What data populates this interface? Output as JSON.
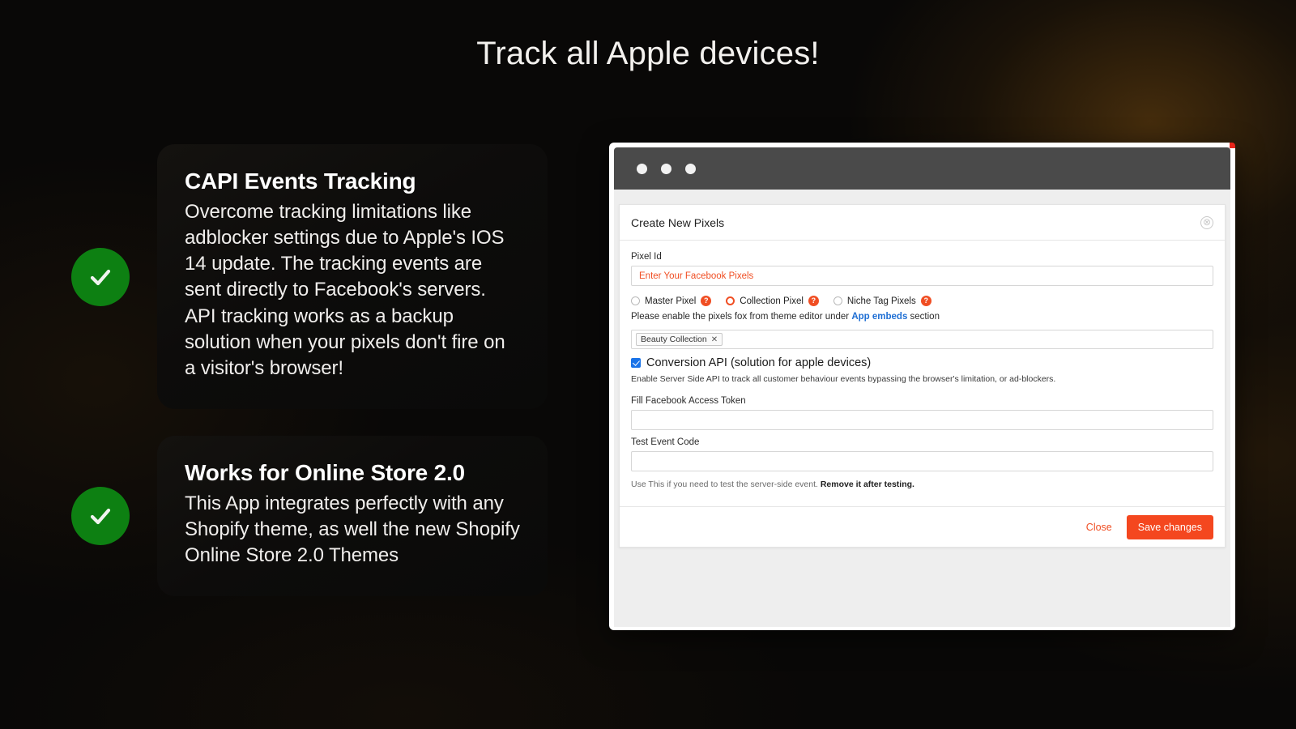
{
  "page": {
    "headline": "Track all Apple devices!",
    "background_color": "#090807",
    "accent_color": "#f4471f",
    "success_color": "#0d8012",
    "link_color": "#1f6fd4"
  },
  "features": [
    {
      "badge_icon": "check-icon",
      "title": "CAPI Events Tracking",
      "body": "Overcome tracking limitations like adblocker settings due to Apple's IOS 14 update. The tracking events are sent directly to Facebook's servers. API tracking works as a backup solution when your pixels don't fire on a visitor's browser!"
    },
    {
      "badge_icon": "check-icon",
      "title": "Works for Online Store 2.0",
      "body": "This App integrates perfectly with any Shopify theme, as well the new Shopify Online Store 2.0 Themes"
    }
  ],
  "browser": {
    "traffic_lights": [
      "dot-1",
      "dot-2",
      "dot-3"
    ],
    "modal": {
      "title": "Create New Pixels",
      "close_icon": "⊗",
      "pixel_id": {
        "label": "Pixel Id",
        "placeholder": "Enter Your Facebook Pixels",
        "value": ""
      },
      "pixel_type_options": [
        {
          "label": "Master Pixel",
          "selected": false,
          "help_icon": "?"
        },
        {
          "label": "Collection Pixel",
          "selected": true,
          "help_icon": "?"
        },
        {
          "label": "Niche Tag Pixels",
          "selected": false,
          "help_icon": "?"
        }
      ],
      "embeds_hint": {
        "prefix": "Please enable the pixels fox from theme editor under ",
        "link": "App embeds",
        "suffix": " section"
      },
      "collection_tags": [
        {
          "label": "Beauty Collection",
          "remove_icon": "✕"
        }
      ],
      "conversion_api": {
        "checked": true,
        "label": "Conversion API (solution for apple devices)",
        "description": "Enable Server Side API to track all customer behaviour events bypassing the browser's limitation, or ad-blockers."
      },
      "access_token": {
        "label": "Fill Facebook Access Token",
        "value": ""
      },
      "test_event_code": {
        "label": "Test Event Code",
        "value": "",
        "note_prefix": "Use This if you need to test the server-side event. ",
        "note_bold": "Remove it after testing."
      },
      "footer": {
        "close_label": "Close",
        "save_label": "Save changes"
      }
    }
  }
}
